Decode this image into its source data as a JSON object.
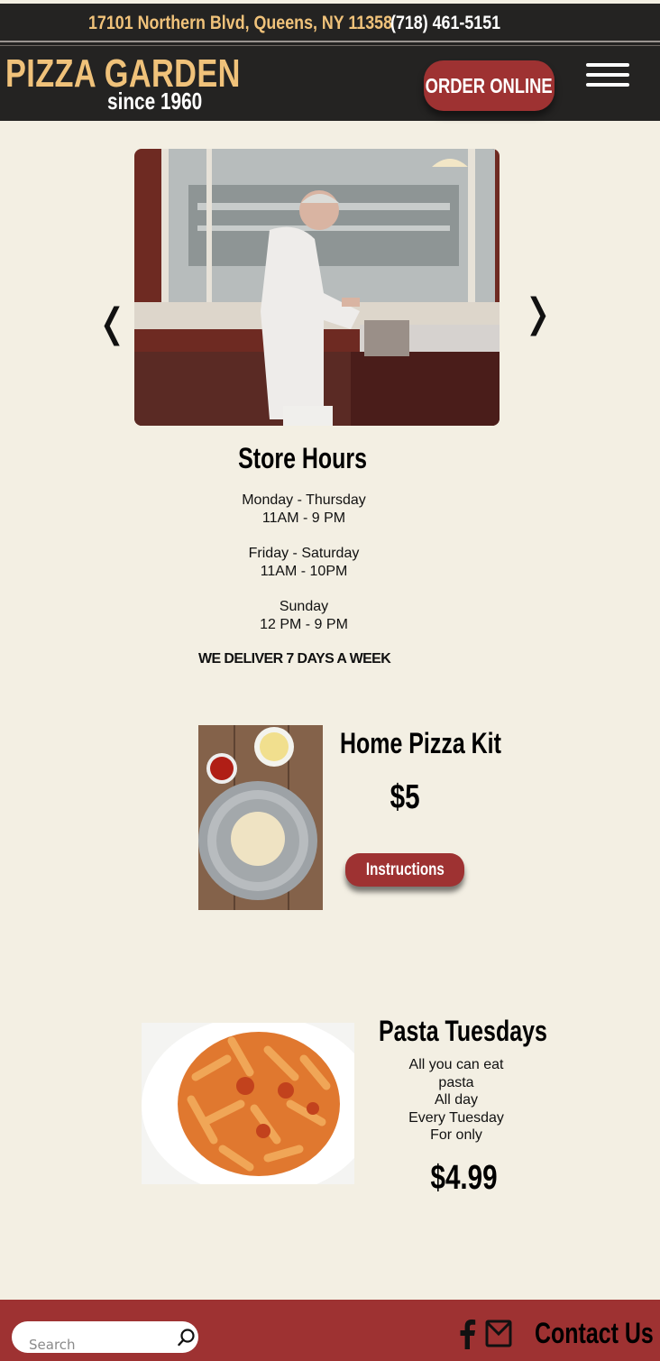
{
  "header": {
    "address": "17101 Northern Blvd, Queens, NY 11358",
    "phone": "(718) 461-5151",
    "brand": "PIZZA GARDEN",
    "since": "since 1960",
    "order_label": "ORDER ONLINE",
    "menu_icon": "hamburger-menu-icon"
  },
  "carousel": {
    "prev_glyph": "❬",
    "next_glyph": "❭"
  },
  "store_hours": {
    "title": "Store Hours",
    "blocks": [
      {
        "days": "Monday - Thursday",
        "time": "11AM - 9 PM"
      },
      {
        "days": "Friday - Saturday",
        "time": "11AM - 10PM"
      },
      {
        "days": "Sunday",
        "time": "12 PM - 9 PM"
      }
    ],
    "delivery_note": "WE DELIVER 7 DAYS A WEEK"
  },
  "pizza_kit": {
    "title": "Home Pizza Kit",
    "price": "$5",
    "button_label": "Instructions"
  },
  "pasta": {
    "title": "Pasta Tuesdays",
    "lines": [
      "All you can eat",
      "pasta",
      "All day",
      "Every Tuesday",
      "For only"
    ],
    "price": "$4.99"
  },
  "footer": {
    "search_placeholder": "Search",
    "contact_label": "Contact Us",
    "icons": [
      "search-icon",
      "facebook-icon",
      "mail-icon"
    ]
  },
  "colors": {
    "header_bg": "#242322",
    "page_bg": "#f3efe3",
    "brand_gold": "#f0c27a",
    "accent_red": "#9e3232"
  }
}
